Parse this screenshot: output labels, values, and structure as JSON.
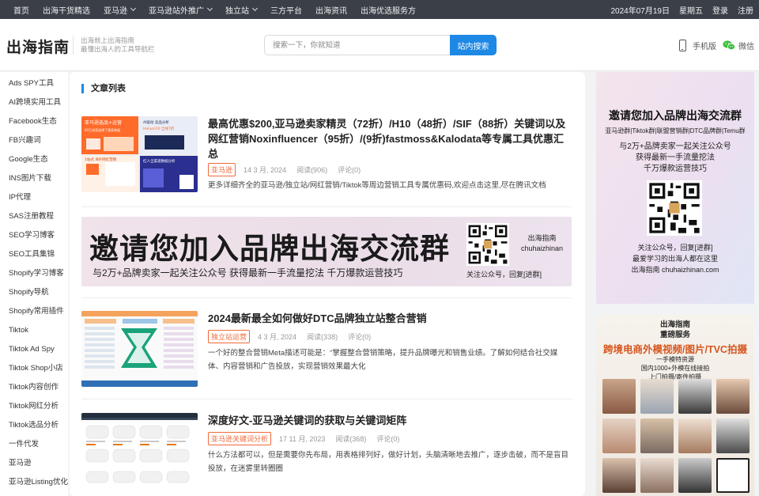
{
  "topbar": {
    "nav": [
      {
        "label": "首页",
        "dropdown": false
      },
      {
        "label": "出海干货精选",
        "dropdown": false
      },
      {
        "label": "亚马逊",
        "dropdown": true
      },
      {
        "label": "亚马逊站外推广",
        "dropdown": true
      },
      {
        "label": "独立站",
        "dropdown": true
      },
      {
        "label": "三方平台",
        "dropdown": false
      },
      {
        "label": "出海资讯",
        "dropdown": false
      },
      {
        "label": "出海优选服务方",
        "dropdown": false
      }
    ],
    "date": "2024年07月19日",
    "weekday": "星期五",
    "login": "登录",
    "register": "注册"
  },
  "header": {
    "logo": "出海指南",
    "slogan_line1": "出海就上出海指南",
    "slogan_line2": "最懂出海人的工具导航栏",
    "search_placeholder": "搜索一下，你就知道",
    "search_button": "站内搜索",
    "mobile_label": "手机版",
    "wechat_label": "微信"
  },
  "sidebar": {
    "items": [
      "Ads SPY工具",
      "AI跨境实用工具",
      "Facebook生态",
      "FB兴趣词",
      "Google生态",
      "INS图片下载",
      "IP代理",
      "SAS注册教程",
      "SEO学习博客",
      "SEO工具集锦",
      "Shopify学习博客",
      "Shopify导航",
      "Shopify常用插件",
      "Tiktok",
      "Tiktok Ad Spy",
      "Tiktok Shop小店",
      "Tiktok内容创作",
      "Tiktok网红分析",
      "Tiktok选品分析",
      "一件代发",
      "亚马逊",
      "亚马逊Listing优化"
    ]
  },
  "main": {
    "section_title": "文章列表",
    "posts": [
      {
        "title": "最高优惠$200,亚马逊卖家精灵（72折）/H10（48折）/SIF（88折）关键词以及网红营销Noxinfluencer（95折）/(9折)fastmoss&Kalodata等专属工具优惠汇总",
        "tag": "亚马逊",
        "date": "14 3 月, 2024",
        "reads": "阅读(906)",
        "comments": "评论(0)",
        "excerpt": "更多详细齐全的亚马逊/独立站/网红营销/Tiktok等周边营销工具专属优惠码,欢迎点击这里,尽在腾讯文档"
      },
      {
        "title": "2024最新最全如何做好DTC品牌独立站整合营销",
        "tag": "独立站运营",
        "date": "4 3 月, 2024",
        "reads": "阅读(338)",
        "comments": "评论(0)",
        "excerpt": "一个好的整合营销Meta描述可能是：“掌握整合营销策略，提升品牌曝光和销售业绩。了解如何结合社交媒体、内容营销和广告投放，实现营销效果最大化"
      },
      {
        "title": "深度好文-亚马逊关键词的获取与关键词矩阵",
        "tag": "亚马逊关键词分析",
        "date": "17 11 月, 2023",
        "reads": "阅读(368)",
        "comments": "评论(0)",
        "excerpt": "什么方法都可以，但是需要你先布局，用表格排列好，做好计划，头脑清晰地去推广，逐步击破，而不是盲目投放，在迷雾里转圈圈"
      }
    ],
    "thumb1": {
      "top_label": "亚马逊选品+运营",
      "top_sub": "60万卖家选择了我家神器",
      "mid_label": "AI驱动 竞品分析",
      "mid_sub": "Helium10 全线7折",
      "bottom_left": "1站式 海外网红营销",
      "bottom_mid": "红人全渠道数据分析"
    },
    "banner": {
      "headline": "邀请您加入品牌出海交流群",
      "subline": "与2万+品牌卖家一起关注公众号    获得最新一手流量挖法  千万爆款运营技巧",
      "brand_cn": "出海指南",
      "brand_en": "chuhaizhinan",
      "follow": "关注公众号，回复[进群]"
    }
  },
  "right": {
    "ad1": {
      "headline": "邀请您加入品牌出海交流群",
      "groups": "亚马逊群|Tiktok群|联盟营销群|DTC品牌群|Temu群",
      "line1": "与2万+品牌卖家一起关注公众号",
      "line2": "获得最新一手流量挖法",
      "line3": "千万爆款运营技巧",
      "line4": "关注公众号，回复[进群]",
      "line5": "最爱学习的出海人都在这里",
      "line6": "出海指南 chuhaizhinan.com"
    },
    "ad2": {
      "brand": "出海指南",
      "service": "重磅服务",
      "headline": "跨境电商外模视频/图片/TVC拍摄",
      "line1": "一手模特资源",
      "line2": "国内1000+外模在线接拍",
      "line3": "上门拍摄/寄件拍摄"
    }
  },
  "colors": {
    "topbar_bg": "#3b3f48",
    "accent_blue": "#1e88e5",
    "tag_orange": "#f06a3a",
    "ad_orange": "#d6561f"
  }
}
